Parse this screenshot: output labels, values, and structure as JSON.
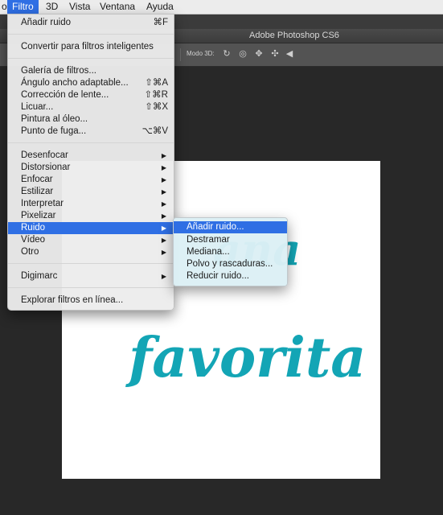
{
  "menubar": {
    "items": [
      {
        "label": "Filtro",
        "active": true
      },
      {
        "label": "3D"
      },
      {
        "label": "Vista"
      },
      {
        "label": "Ventana"
      },
      {
        "label": "Ayuda"
      }
    ]
  },
  "window": {
    "title": "Adobe Photoshop CS6"
  },
  "options_bar": {
    "mode_label": "Modo 3D:"
  },
  "canvas": {
    "text_line1": "ana",
    "text_line2": "favorita"
  },
  "filter_menu": {
    "items": [
      {
        "label": "Añadir ruido",
        "shortcut": "⌘F"
      },
      {
        "label": "Convertir para filtros inteligentes"
      },
      {
        "label": "Galería de filtros..."
      },
      {
        "label": "Ángulo ancho adaptable...",
        "shortcut": "⇧⌘A"
      },
      {
        "label": "Corrección de lente...",
        "shortcut": "⇧⌘R"
      },
      {
        "label": "Licuar...",
        "shortcut": "⇧⌘X"
      },
      {
        "label": "Pintura al óleo..."
      },
      {
        "label": "Punto de fuga...",
        "shortcut": "⌥⌘V"
      },
      {
        "label": "Desenfocar",
        "arrow": "▶"
      },
      {
        "label": "Distorsionar",
        "arrow": "▶"
      },
      {
        "label": "Enfocar",
        "arrow": "▶"
      },
      {
        "label": "Estilizar",
        "arrow": "▶"
      },
      {
        "label": "Interpretar",
        "arrow": "▶"
      },
      {
        "label": "Pixelizar",
        "arrow": "▶"
      },
      {
        "label": "Ruido",
        "arrow": "▶",
        "highlighted": true
      },
      {
        "label": "Vídeo",
        "arrow": "▶"
      },
      {
        "label": "Otro",
        "arrow": "▶"
      },
      {
        "label": "Digimarc",
        "arrow": "▶"
      },
      {
        "label": "Explorar filtros en línea..."
      }
    ]
  },
  "noise_submenu": {
    "items": [
      {
        "label": "Añadir ruido...",
        "highlighted": true
      },
      {
        "label": "Destramar"
      },
      {
        "label": "Mediana..."
      },
      {
        "label": "Polvo y rascaduras..."
      },
      {
        "label": "Reducir ruido..."
      }
    ]
  },
  "colors": {
    "accent": "#2f6fe4",
    "text_teal": "#13a5b5"
  }
}
